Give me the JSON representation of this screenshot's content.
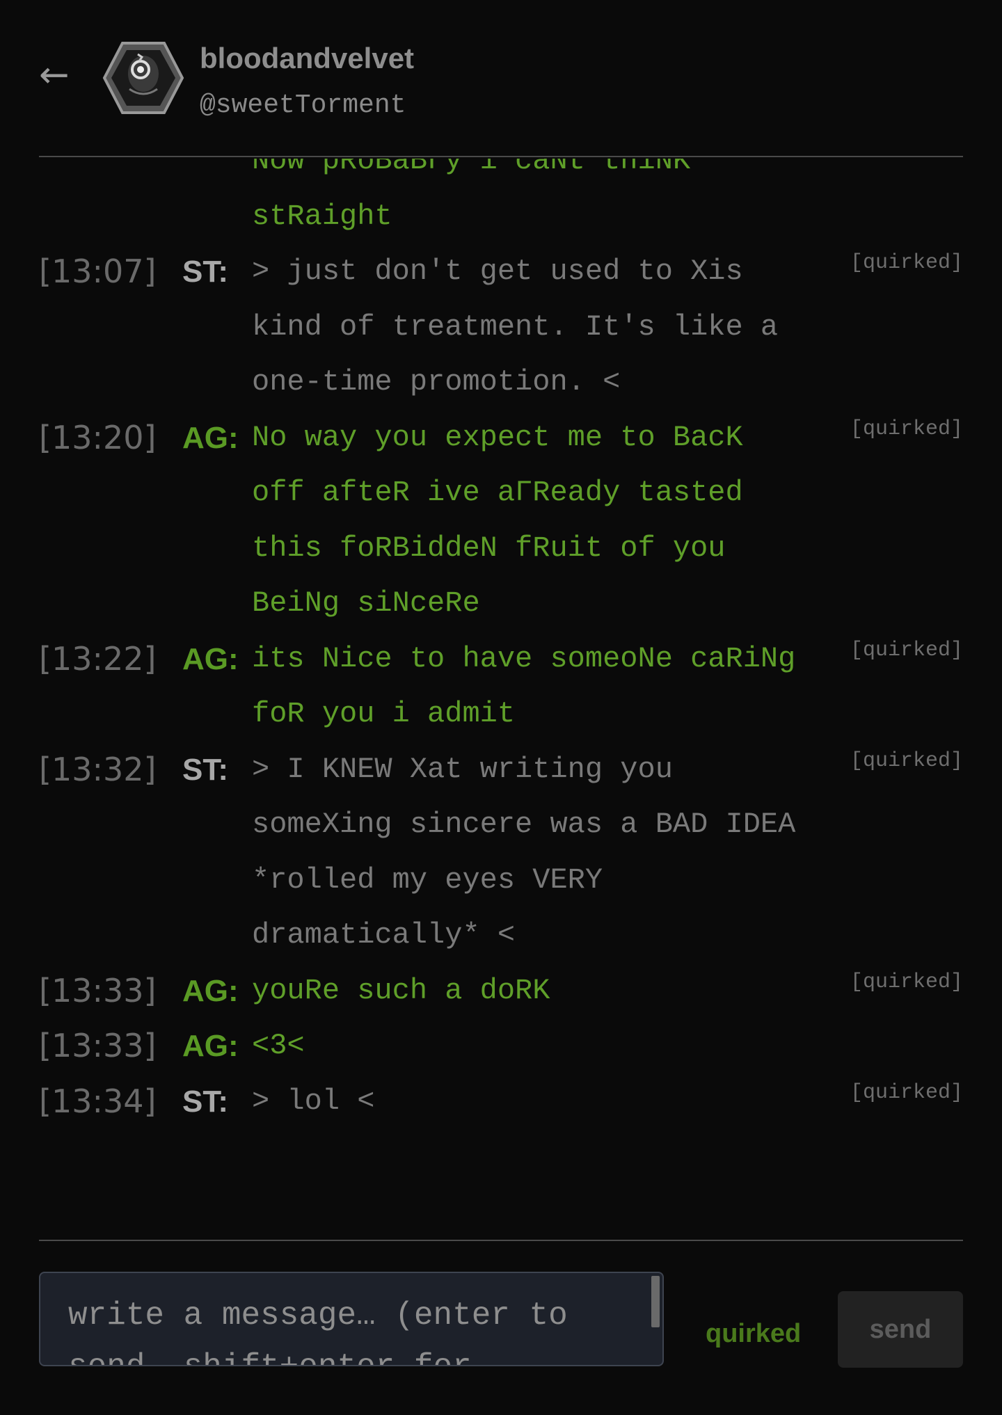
{
  "header": {
    "back_icon": "back-arrow-icon",
    "avatar_icon": "hexagon-avatar-icon",
    "name": "bloodandvelvet",
    "handle": "@sweetTorment"
  },
  "colors": {
    "ag": "#5f9f29",
    "st": "#7a7a7a",
    "background": "#0a0a0a"
  },
  "messages": [
    {
      "time": "",
      "tag": "",
      "who": "ag",
      "text": "Now pRoBaBΓy i caNt thiNK stRaight",
      "quirk": "",
      "continuation": true
    },
    {
      "time": "[13:07]",
      "tag": "ST:",
      "who": "st",
      "text": "> just don't get used to Xis kind of treatment. It's like a one-time promotion. <",
      "quirk": "[quirked]"
    },
    {
      "time": "[13:20]",
      "tag": "AG:",
      "who": "ag",
      "text": "No way you expect me to BacK off afteR ive aΓReady tasted this foRBiddeN fRuit of you BeiNg siNceRe",
      "quirk": "[quirked]"
    },
    {
      "time": "[13:22]",
      "tag": "AG:",
      "who": "ag",
      "text": "its Nice to have someoNe caRiNg foR you i admit",
      "quirk": "[quirked]"
    },
    {
      "time": "[13:32]",
      "tag": "ST:",
      "who": "st",
      "text": "> I KNEW Xat writing you someXing sincere was a BAD IDEA *rolled my eyes VERY dramatically* <",
      "quirk": "[quirked]"
    },
    {
      "time": "[13:33]",
      "tag": "AG:",
      "who": "ag",
      "text": "youRe such a doRK",
      "quirk": "[quirked]"
    },
    {
      "time": "[13:33]",
      "tag": "AG:",
      "who": "ag",
      "text": "<3<",
      "quirk": ""
    },
    {
      "time": "[13:34]",
      "tag": "ST:",
      "who": "st",
      "text": "> lol <",
      "quirk": "[quirked]"
    }
  ],
  "composer": {
    "placeholder": "write a message… (enter to send, shift+enter for newline)",
    "quirk_label": "quirked",
    "send_label": "send"
  }
}
